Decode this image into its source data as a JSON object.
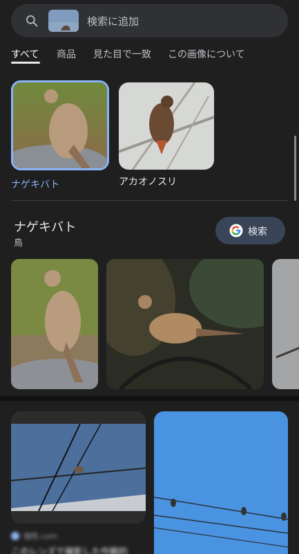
{
  "search": {
    "placeholder": "検索に追加",
    "icon": "search-icon"
  },
  "tabs": [
    {
      "label": "すべて",
      "active": true
    },
    {
      "label": "商品",
      "active": false
    },
    {
      "label": "見た目で一致",
      "active": false
    },
    {
      "label": "この画像について",
      "active": false
    }
  ],
  "matches": [
    {
      "label": "ナゲキバト",
      "selected": true
    },
    {
      "label": "アカオノスリ",
      "selected": false
    }
  ],
  "knowledge": {
    "title": "ナゲキバト",
    "subtitle": "鳥",
    "search_button": "検索"
  },
  "results": {
    "site_name": "個性.com",
    "caption": "このレンズで撮影した作戦的"
  },
  "colors": {
    "background": "#1f1f1f",
    "accent": "#8ab4f8",
    "search_button_bg": "#394457"
  }
}
